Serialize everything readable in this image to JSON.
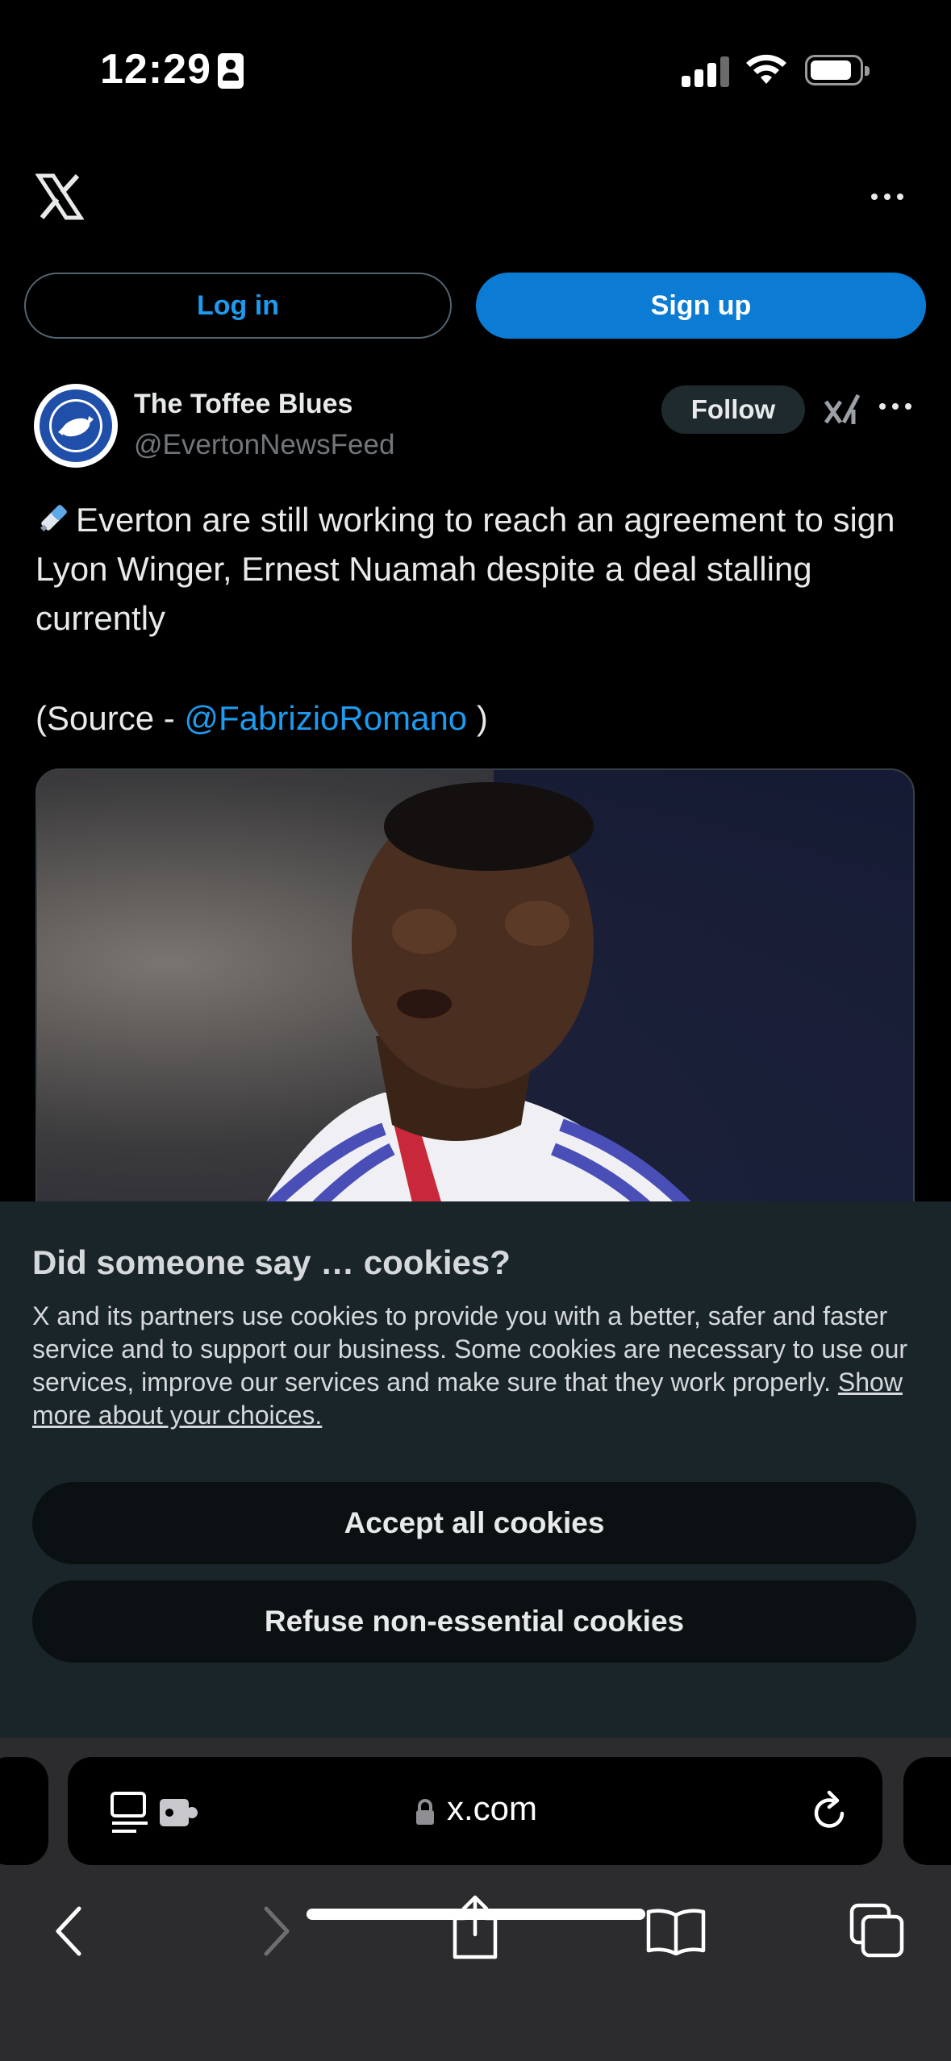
{
  "status_bar": {
    "time": "12:29"
  },
  "header": {
    "logo_icon": "x-logo-icon",
    "more_icon": "ellipsis-icon"
  },
  "auth": {
    "login_label": "Log in",
    "signup_label": "Sign up"
  },
  "tweet": {
    "display_name": "The Toffee Blues",
    "handle": "@EvertonNewsFeed",
    "follow_label": "Follow",
    "text": "Everton are still working to reach an agreement to sign Lyon Winger, Ernest Nuamah despite a deal stalling currently",
    "source_prefix": "(Source - ",
    "source_mention": "@FabrizioRomano",
    "source_suffix": " )"
  },
  "cookies": {
    "title": "Did someone say … cookies?",
    "body": "X and its partners use cookies to provide you with a better, safer and faster service and to support our business. Some cookies are necessary to use our services, improve our services and make sure that they work properly. ",
    "link": "Show more about your choices.",
    "accept_label": "Accept all cookies",
    "refuse_label": "Refuse non-essential cookies"
  },
  "browser": {
    "url": "x.com"
  },
  "colors": {
    "accent": "#1d9bf0",
    "signup_bg": "#0b7bd3",
    "cookie_sheet": "#1a2529",
    "safari_chrome": "#2c2c2e"
  }
}
